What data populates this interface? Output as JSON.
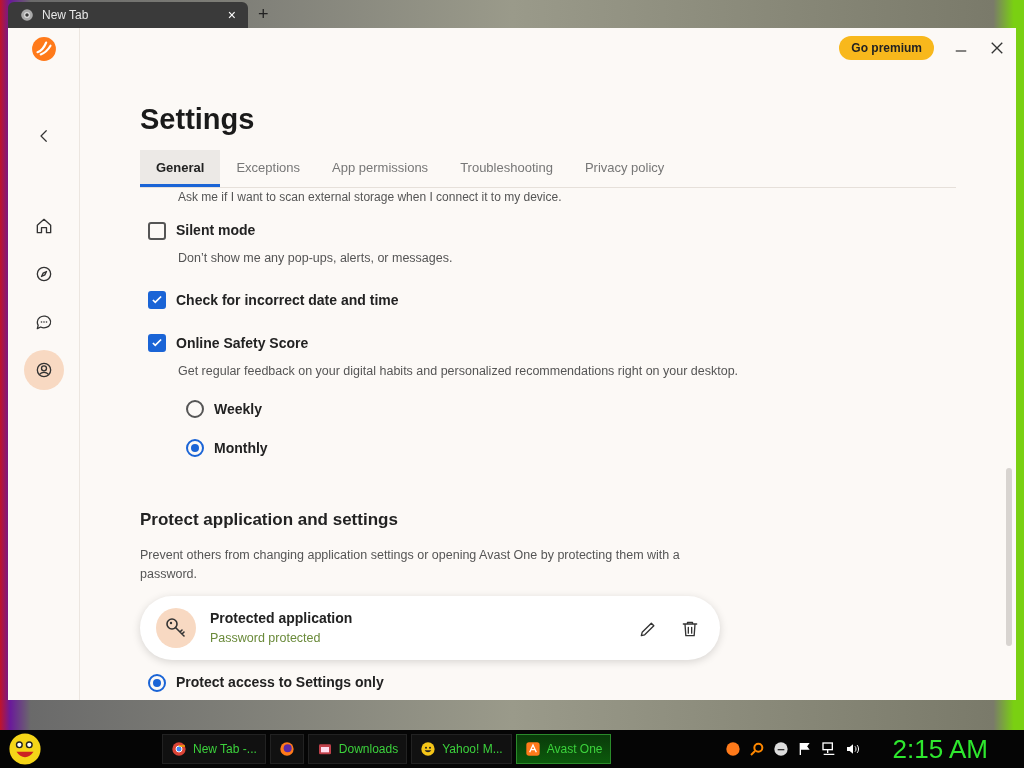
{
  "browser_tab": {
    "title": "New Tab",
    "close": "×",
    "new_tab": "+"
  },
  "app": {
    "premium_button": "Go premium",
    "title": "Settings",
    "sidebar": [
      {
        "selected": false
      },
      {
        "selected": false
      },
      {
        "selected": false
      },
      {
        "selected": true
      }
    ],
    "tabs": [
      {
        "label": "General",
        "selected": true
      },
      {
        "label": "Exceptions",
        "selected": false
      },
      {
        "label": "App permissions",
        "selected": false
      },
      {
        "label": "Troubleshooting",
        "selected": false
      },
      {
        "label": "Privacy policy",
        "selected": false
      }
    ],
    "options": [
      {
        "kind": "caption",
        "text": "Ask me if I want to scan external storage when I connect it to my device."
      },
      {
        "kind": "checkbox",
        "label": "Silent mode",
        "checked": false,
        "description": "Don’t show me any pop-ups, alerts, or messages."
      },
      {
        "kind": "checkbox",
        "label": "Check for incorrect date and time",
        "checked": true
      },
      {
        "kind": "checkbox",
        "label": "Online Safety Score",
        "checked": true,
        "description": "Get regular feedback on your digital habits and personalized recommendations right on your desktop.",
        "radios": [
          {
            "label": "Weekly",
            "selected": false
          },
          {
            "label": "Monthly",
            "selected": true
          }
        ]
      }
    ],
    "section": {
      "title": "Protect application and settings",
      "description": "Prevent others from changing application settings or opening Avast One by protecting them with a password.",
      "card": {
        "title": "Protected application",
        "status": "Password protected"
      },
      "radios": [
        {
          "label": "Protect access to Settings only",
          "selected": true
        }
      ]
    }
  },
  "taskbar": {
    "items": [
      {
        "label": "New Tab -...",
        "selected": false
      },
      {
        "selected": false
      },
      {
        "label": "Downloads",
        "selected": false
      },
      {
        "label": "Yahoo! M...",
        "selected": false
      },
      {
        "label": "Avast One",
        "selected": true
      }
    ],
    "clock": "2:15 AM"
  }
}
